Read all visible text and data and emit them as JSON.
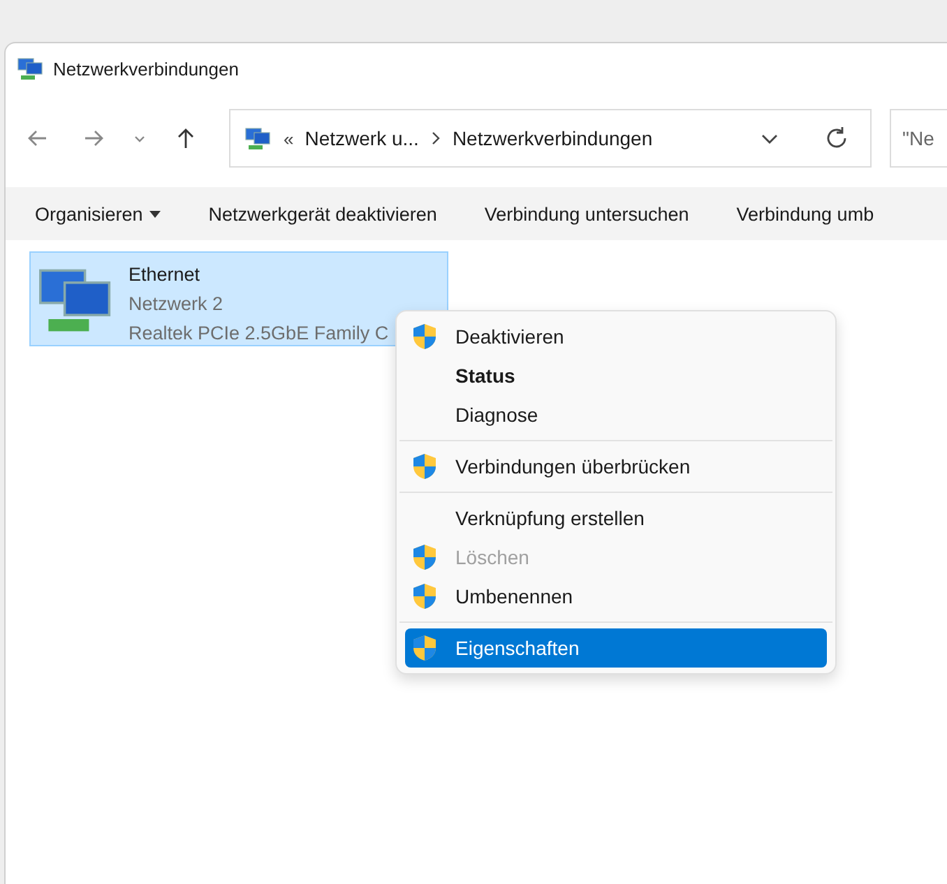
{
  "window": {
    "title": "Netzwerkverbindungen"
  },
  "address_bar": {
    "overflow": "«",
    "path": [
      {
        "label": "Netzwerk u..."
      },
      {
        "label": "Netzwerkverbindungen"
      }
    ]
  },
  "search": {
    "placeholder": "\"Ne"
  },
  "toolbar": [
    {
      "label": "Organisieren",
      "dropdown": true
    },
    {
      "label": "Netzwerkgerät deaktivieren",
      "dropdown": false
    },
    {
      "label": "Verbindung untersuchen",
      "dropdown": false
    },
    {
      "label": "Verbindung umb",
      "dropdown": false
    }
  ],
  "connections": [
    {
      "name": "Ethernet",
      "network": "Netzwerk 2",
      "adapter": "Realtek PCIe 2.5GbE Family C",
      "selected": true
    }
  ],
  "context_menu": [
    {
      "kind": "item",
      "label": "Deaktivieren",
      "shield": true,
      "bold": false,
      "disabled": false,
      "selected": false
    },
    {
      "kind": "item",
      "label": "Status",
      "shield": false,
      "bold": true,
      "disabled": false,
      "selected": false
    },
    {
      "kind": "item",
      "label": "Diagnose",
      "shield": false,
      "bold": false,
      "disabled": false,
      "selected": false
    },
    {
      "kind": "separator"
    },
    {
      "kind": "item",
      "label": "Verbindungen überbrücken",
      "shield": true,
      "bold": false,
      "disabled": false,
      "selected": false
    },
    {
      "kind": "separator"
    },
    {
      "kind": "item",
      "label": "Verknüpfung erstellen",
      "shield": false,
      "bold": false,
      "disabled": false,
      "selected": false
    },
    {
      "kind": "item",
      "label": "Löschen",
      "shield": true,
      "bold": false,
      "disabled": true,
      "selected": false
    },
    {
      "kind": "item",
      "label": "Umbenennen",
      "shield": true,
      "bold": false,
      "disabled": false,
      "selected": false
    },
    {
      "kind": "separator"
    },
    {
      "kind": "item",
      "label": "Eigenschaften",
      "shield": true,
      "bold": false,
      "disabled": false,
      "selected": true
    }
  ]
}
